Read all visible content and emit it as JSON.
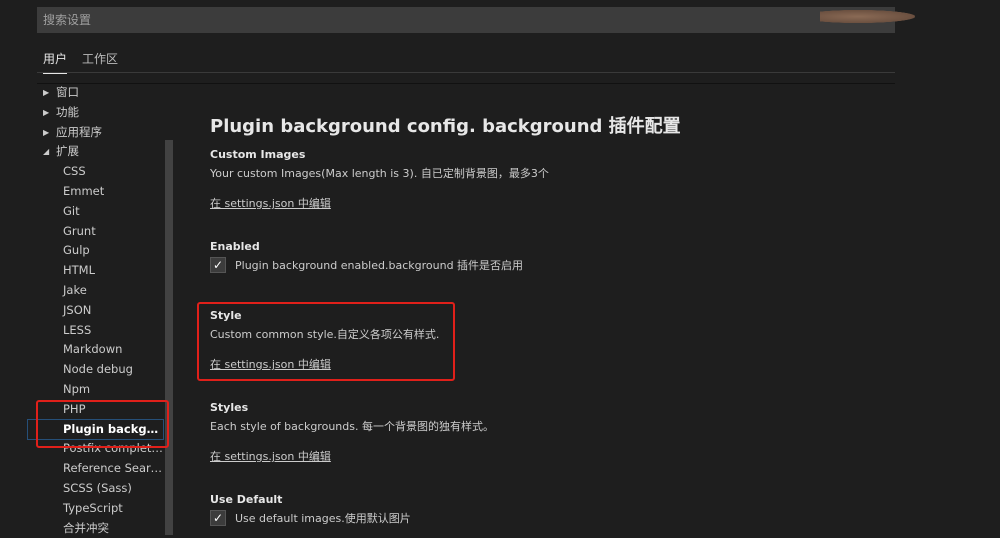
{
  "search": {
    "placeholder": "搜索设置"
  },
  "tabs": [
    {
      "label": "用户"
    },
    {
      "label": "工作区"
    }
  ],
  "tree": [
    {
      "label": "窗口",
      "caret": "▶"
    },
    {
      "label": "功能",
      "caret": "▶"
    },
    {
      "label": "应用程序",
      "caret": "▶"
    },
    {
      "label": "扩展",
      "caret": "◢"
    }
  ],
  "extensions": [
    "CSS",
    "Emmet",
    "Git",
    "Grunt",
    "Gulp",
    "HTML",
    "Jake",
    "JSON",
    "LESS",
    "Markdown",
    "Node debug",
    "Npm",
    "PHP",
    "Plugin background config. background",
    "Postfix completion",
    "Reference Search View",
    "SCSS (Sass)",
    "TypeScript",
    "合并冲突"
  ],
  "content": {
    "title": "Plugin background config. background 插件配置",
    "settings": [
      {
        "title": "Custom Images",
        "desc": "Your custom Images(Max length is 3). 自已定制背景图，最多3个",
        "link": "在 settings.json 中编辑"
      },
      {
        "title": "Enabled",
        "checkbox": "Plugin background enabled.background 插件是否启用",
        "checked": true
      },
      {
        "title": "Style",
        "desc": "Custom common style.自定义各项公有样式.",
        "link": "在 settings.json 中编辑"
      },
      {
        "title": "Styles",
        "desc": "Each style of backgrounds. 每一个背景图的独有样式。",
        "link": "在 settings.json 中编辑"
      },
      {
        "title": "Use Default",
        "checkbox": "Use default images.使用默认图片",
        "checked": true
      }
    ]
  },
  "check_glyph": "✓"
}
